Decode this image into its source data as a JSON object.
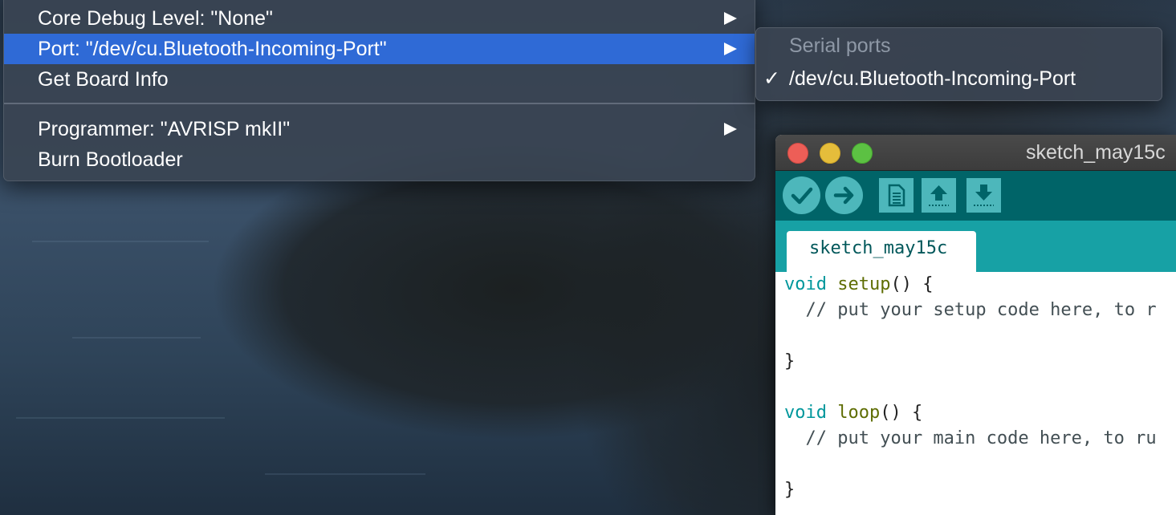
{
  "menu": {
    "items": [
      {
        "label": "Core Debug Level: \"None\"",
        "has_submenu": true,
        "highlighted": false
      },
      {
        "label": "Port: \"/dev/cu.Bluetooth-Incoming-Port\"",
        "has_submenu": true,
        "highlighted": true
      },
      {
        "label": "Get Board Info",
        "has_submenu": false,
        "highlighted": false
      },
      {
        "label": "Programmer: \"AVRISP mkII\"",
        "has_submenu": true,
        "highlighted": false
      },
      {
        "label": "Burn Bootloader",
        "has_submenu": false,
        "highlighted": false
      }
    ]
  },
  "submenu": {
    "section_header": "Serial ports",
    "ports": [
      {
        "label": "/dev/cu.Bluetooth-Incoming-Port",
        "checked": true,
        "check_glyph": "✓"
      }
    ]
  },
  "window": {
    "title": "sketch_may15c",
    "toolbar": {
      "buttons": [
        {
          "name": "verify",
          "icon": "check-icon"
        },
        {
          "name": "upload",
          "icon": "arrow-right-icon"
        },
        {
          "name": "new",
          "icon": "document-icon"
        },
        {
          "name": "open",
          "icon": "arrow-up-icon"
        },
        {
          "name": "save",
          "icon": "arrow-down-icon"
        }
      ]
    },
    "tab": {
      "label": "sketch_may15c"
    },
    "code": {
      "line1": {
        "kw": "void",
        "fn": "setup",
        "rest": "() {"
      },
      "line2": "  // put your setup code here, to r",
      "line4": "}",
      "line6": {
        "kw": "void",
        "fn": "loop",
        "rest": "() {"
      },
      "line7": "  // put your main code here, to ru",
      "line9": "}"
    }
  },
  "colors": {
    "menu_highlight": "#2f6ad6",
    "toolbar": "#006468",
    "tabbar": "#17a1a5",
    "toolbar_button": "#4db7bb",
    "keyword": "#00979c",
    "function": "#5e6d03"
  }
}
